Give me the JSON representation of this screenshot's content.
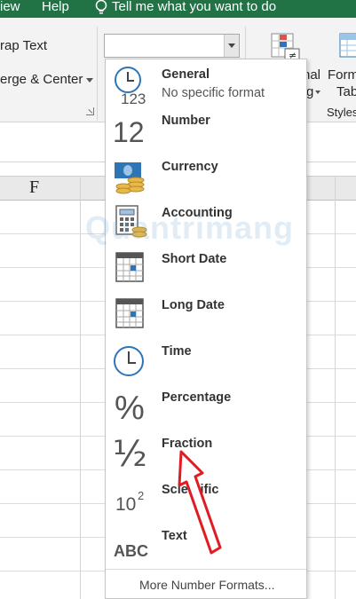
{
  "ribbon": {
    "tabs": [
      "iew",
      "Help"
    ],
    "tell_me": "Tell me what you want to do",
    "wrap_text": "rap Text",
    "merge_center": "erge & Center",
    "cond_format_label_1": "nal",
    "cond_format_label_2": "g",
    "format_table_label_1": "Form",
    "format_table_label_2": "Tab",
    "styles_group": "Styles",
    "number_format_value": ""
  },
  "sheet": {
    "column_header": "F"
  },
  "dropdown": {
    "items": [
      {
        "label": "General",
        "sub": "No specific format",
        "icon": "clock-123-icon"
      },
      {
        "label": "Number",
        "icon": "number-12-icon"
      },
      {
        "label": "Currency",
        "icon": "currency-icon"
      },
      {
        "label": "Accounting",
        "icon": "calculator-icon"
      },
      {
        "label": "Short Date",
        "icon": "calendar-icon"
      },
      {
        "label": "Long Date",
        "icon": "calendar-icon"
      },
      {
        "label": "Time",
        "icon": "clock-icon"
      },
      {
        "label": "Percentage",
        "icon": "percent-icon"
      },
      {
        "label": "Fraction",
        "icon": "fraction-icon"
      },
      {
        "label": "Scientific",
        "icon": "scientific-icon"
      },
      {
        "label": "Text",
        "icon": "abc-icon"
      }
    ],
    "more": "More Number Formats..."
  },
  "icon_text": {
    "general_num": "123",
    "number_num": "12",
    "percent": "%",
    "fraction": "½",
    "sci_base": "10",
    "sci_exp": "2",
    "abc": "ABC"
  },
  "overlay": {
    "watermark": "Quantrimang"
  },
  "colors": {
    "excel_green": "#217346",
    "icon_blue": "#2e75b6",
    "arrow_red": "#e01b24"
  }
}
